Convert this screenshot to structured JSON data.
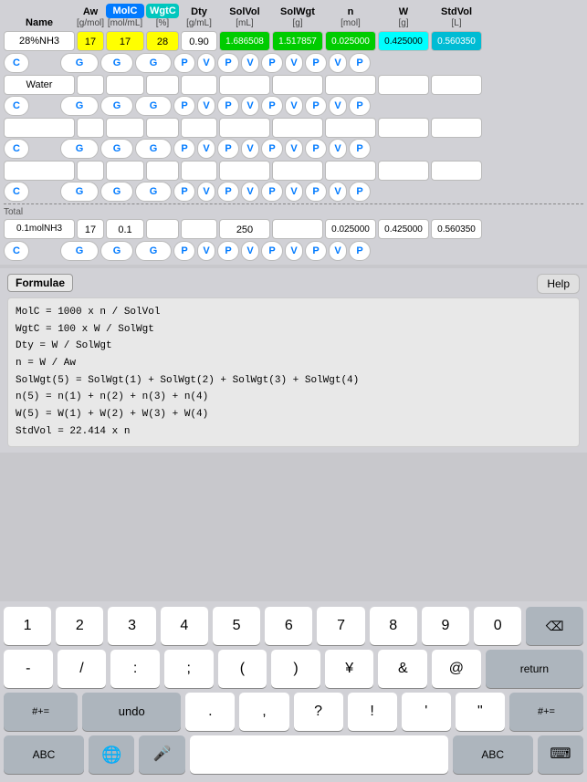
{
  "header": {
    "cols": [
      {
        "label": "Name",
        "unit": ""
      },
      {
        "label": "Aw",
        "unit": "[g/mol]"
      },
      {
        "label": "MolC",
        "unit": "[mol/mL]"
      },
      {
        "label": "WgtC",
        "unit": "[%]"
      },
      {
        "label": "Dty",
        "unit": "[g/mL]"
      },
      {
        "label": "SolVol",
        "unit": "[mL]"
      },
      {
        "label": "SolWgt",
        "unit": "[g]"
      },
      {
        "label": "n",
        "unit": "[mol]"
      },
      {
        "label": "W",
        "unit": "[g]"
      },
      {
        "label": "StdVol",
        "unit": "[L]"
      }
    ]
  },
  "rows": [
    {
      "name": "28%NH3",
      "aw": "17",
      "molc": "17",
      "wgtc": "28",
      "dty": "0.90",
      "solvol": "1.686508",
      "solwgt": "1.517857",
      "n": "0.025000",
      "w": "0.425000",
      "stdvol": "0.560350"
    }
  ],
  "component_rows": [
    {
      "name": "Water",
      "aw": "",
      "molc": "",
      "wgtc": "",
      "dty": "",
      "solvol": "",
      "solwgt": "",
      "n": "",
      "w": "",
      "stdvol": ""
    },
    {
      "name": "",
      "aw": "",
      "molc": "",
      "wgtc": "",
      "dty": "",
      "solvol": "",
      "solwgt": "",
      "n": "",
      "w": "",
      "stdvol": ""
    },
    {
      "name": "",
      "aw": "",
      "molc": "",
      "wgtc": "",
      "dty": "",
      "solvol": "",
      "solwgt": "",
      "n": "",
      "w": "",
      "stdvol": ""
    },
    {
      "name": "",
      "aw": "",
      "molc": "",
      "wgtc": "",
      "dty": "",
      "solvol": "",
      "solwgt": "",
      "n": "",
      "w": "",
      "stdvol": ""
    }
  ],
  "total_row": {
    "label": "Total",
    "name": "0.1molNH3",
    "aw": "17",
    "molc": "0.1",
    "wgtc": "",
    "dty": "",
    "solvol": "250",
    "solwgt": "",
    "n": "0.025000",
    "w": "0.425000",
    "stdvol": "0.560350"
  },
  "formulae": {
    "title": "Formulae",
    "help_label": "Help",
    "lines": [
      "MolC = 1000 x n / SolVol",
      "WgtC = 100 x W / SolWgt",
      "Dty   = W / SolWgt",
      "n  = W / Aw",
      "SolWgt(5) = SolWgt(1) + SolWgt(2) + SolWgt(3) + SolWgt(4)",
      "n(5)       = n(1) + n(2) + n(3) + n(4)",
      "W(5)       = W(1) + W(2) + W(3) + W(4)",
      "StdVol = 22.414 x n"
    ]
  },
  "keyboard": {
    "rows": [
      [
        "1",
        "2",
        "3",
        "4",
        "5",
        "6",
        "7",
        "8",
        "9",
        "0"
      ],
      [
        "-",
        "/",
        ":",
        ";",
        "(",
        ")",
        "¥",
        "&",
        "@",
        "return"
      ],
      [
        "#+=",
        "undo",
        ".",
        ",",
        "?",
        "!",
        "'",
        "\"",
        "#+="
      ],
      [
        "ABC",
        "🌐",
        "🎤",
        "",
        "",
        "",
        "",
        "",
        "ABC",
        "⌨"
      ]
    ]
  }
}
